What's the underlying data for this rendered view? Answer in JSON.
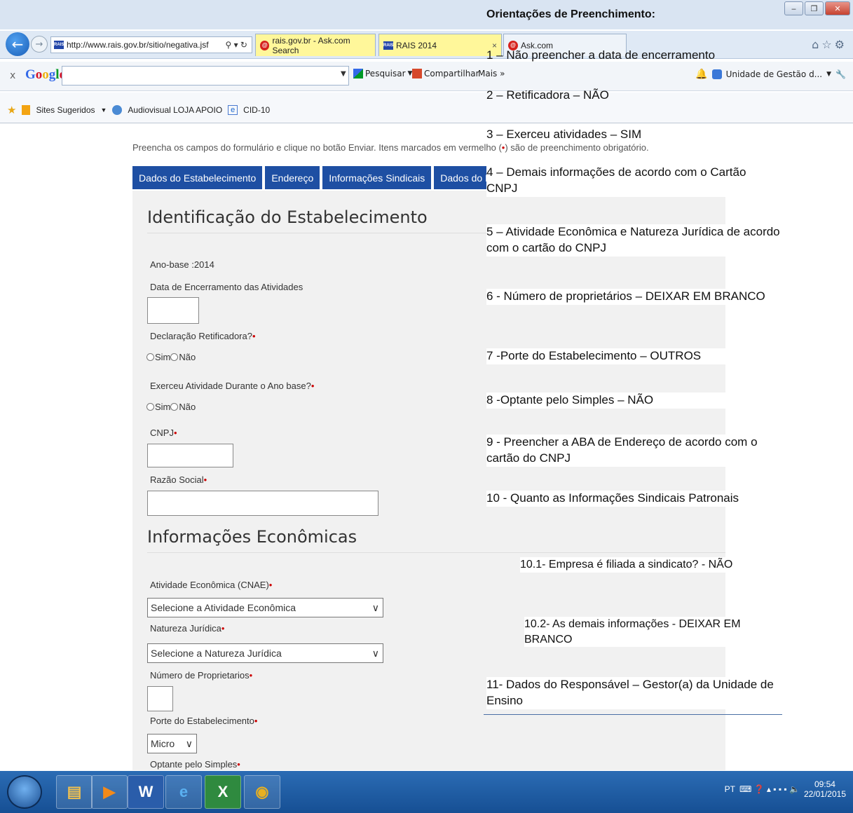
{
  "browser": {
    "url": "http://www.rais.gov.br/sitio/negativa.jsf",
    "tabs": [
      {
        "label": "rais.gov.br - Ask.com Search"
      },
      {
        "label": "RAIS 2014"
      },
      {
        "label": "Ask.com"
      }
    ],
    "favicon_text": "RAIS",
    "google": {
      "close": "x",
      "search_label": "Pesquisar",
      "share_label": "Compartilhar",
      "more_label": "Mais »",
      "account_label": "Unidade de Gestão d..."
    },
    "favorites": {
      "suggested": "Sites Sugeridos",
      "audiovisual": "Audiovisual  LOJA APOIO",
      "cid": "CID-10"
    }
  },
  "page": {
    "instructions_before": "Preencha os campos do formulário e clique no botão Enviar. Itens marcados em vermelho (",
    "instructions_mark": "•",
    "instructions_after": ") são de preenchimento obrigatório.",
    "tabs": [
      {
        "label": "Dados do Estabelecimento"
      },
      {
        "label": "Endereço"
      },
      {
        "label": "Informações Sindicais"
      },
      {
        "label": "Dados do Responsável"
      }
    ],
    "section1_title": "Identificação do Estabelecimento",
    "ano_base": "Ano-base :2014",
    "data_encerramento_label": "Data de Encerramento das Atividades",
    "retificadora_label": "Declaração Retificadora?",
    "exerceu_label": "Exerceu Atividade Durante o Ano base?",
    "radio_sim": "Sim",
    "radio_nao": "Não",
    "cnpj_label": "CNPJ",
    "razao_label": "Razão Social",
    "section2_title": "Informações Econômicas",
    "atividade_label": "Atividade Econômica (CNAE)",
    "atividade_value": "Selecione a Atividade Econômica",
    "natureza_label": "Natureza Jurídica",
    "natureza_value": "Selecione a Natureza Jurídica",
    "proprietarios_label": "Número de Proprietarios",
    "porte_label": "Porte do Estabelecimento",
    "porte_value": "Micro",
    "simples_label": "Optante pelo Simples",
    "req_mark": "•"
  },
  "notes": {
    "title": "Orientações de Preenchimento:",
    "items": [
      "1 – Não preencher a data de encerramento",
      "2 – Retificadora – NÃO",
      "3 – Exerceu atividades – SIM",
      "4 – Demais informações de acordo com o Cartão CNPJ",
      "5 – Atividade Econômica  e Natureza Jurídica de acordo com o cartão do CNPJ",
      "6 - Número de proprietários – DEIXAR  EM BRANCO",
      "7 -Porte do Estabelecimento  – OUTROS",
      "8 -Optante pelo Simples  – NÃO",
      "9 - Preencher a ABA de Endereço de acordo com o cartão do CNPJ",
      "10 - Quanto as Informações  Sindicais Patronais",
      "10.1- Empresa é filiada a sindicato? - NÃO",
      "10.2- As demais informações  - DEIXAR EM BRANCO",
      "11- Dados do Responsável –  Gestor(a)  da Unidade de Ensino"
    ]
  },
  "taskbar": {
    "lang": "PT",
    "time": "09:54",
    "date": "22/01/2015"
  },
  "colors": {
    "tab_blue": "#1e4fa3",
    "required_red": "#cc0000",
    "form_bg": "#f1f1f1",
    "taskbar_blue": "#1f5ea4"
  }
}
